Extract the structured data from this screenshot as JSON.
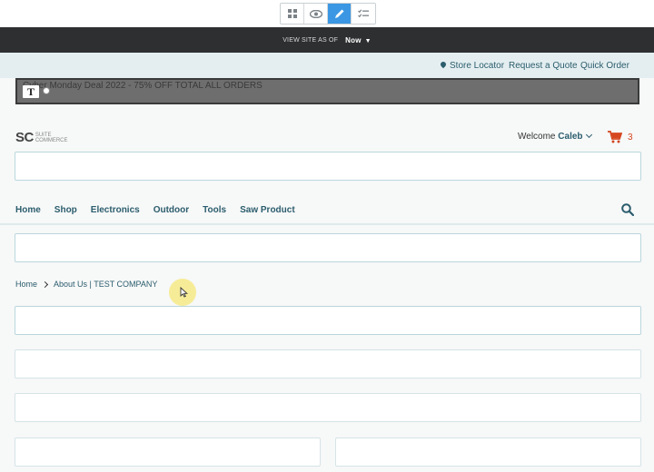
{
  "editor_toolbar": {
    "tools": [
      {
        "icon": "grid-icon",
        "active": false
      },
      {
        "icon": "eye-icon",
        "active": false
      },
      {
        "icon": "pencil-icon",
        "active": true
      },
      {
        "icon": "checklist-icon",
        "active": false
      }
    ]
  },
  "view_bar": {
    "label": "VIEW SITE AS OF",
    "value": "Now"
  },
  "header_links": {
    "store_locator": "Store Locator",
    "request_quote": "Request a Quote",
    "quick_order": "Quick Order"
  },
  "promo": {
    "text": "Cyber Monday Deal 2022 - 75% OFF TOTAL ALL ORDERS",
    "badge": "T"
  },
  "logo": {
    "mark": "SC",
    "sub_line1": "Suite",
    "sub_line2": "Commerce"
  },
  "account": {
    "welcome_label": "Welcome",
    "user_name": "Caleb",
    "cart_count": "3"
  },
  "nav": {
    "items": [
      "Home",
      "Shop",
      "Electronics",
      "Outdoor",
      "Tools",
      "Saw Product"
    ]
  },
  "breadcrumb": {
    "home": "Home",
    "current": "About Us | TEST COMPANY"
  },
  "colors": {
    "accent_blue": "#3b97e3",
    "brand_teal": "#2b5d6d",
    "cart_red": "#d6461f",
    "dark_bar": "#2d2f31"
  }
}
